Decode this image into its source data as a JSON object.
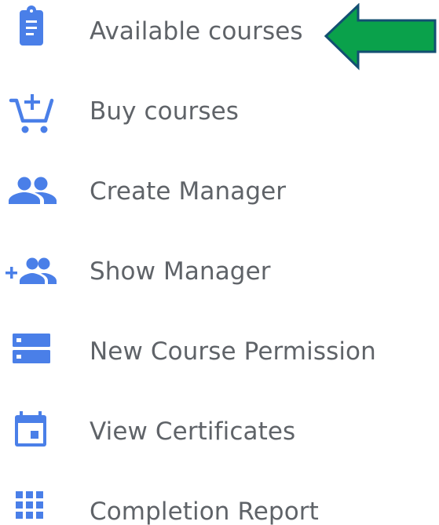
{
  "colors": {
    "icon": "#4a7fe8",
    "text": "#5f6368",
    "arrow_fill": "#0aa14b",
    "arrow_stroke": "#134f72"
  },
  "menu": {
    "items": [
      {
        "label": "Available courses",
        "icon": "clipboard-icon"
      },
      {
        "label": "Buy courses",
        "icon": "cart-plus-icon"
      },
      {
        "label": "Create Manager",
        "icon": "people-icon"
      },
      {
        "label": "Show Manager",
        "icon": "group-add-icon"
      },
      {
        "label": "New Course Permission",
        "icon": "storage-icon"
      },
      {
        "label": "View Certificates",
        "icon": "calendar-icon"
      },
      {
        "label": "Completion Report",
        "icon": "grid-icon"
      }
    ]
  },
  "annotation": {
    "icon": "green-left-arrow-icon",
    "points_to": "Available courses"
  }
}
